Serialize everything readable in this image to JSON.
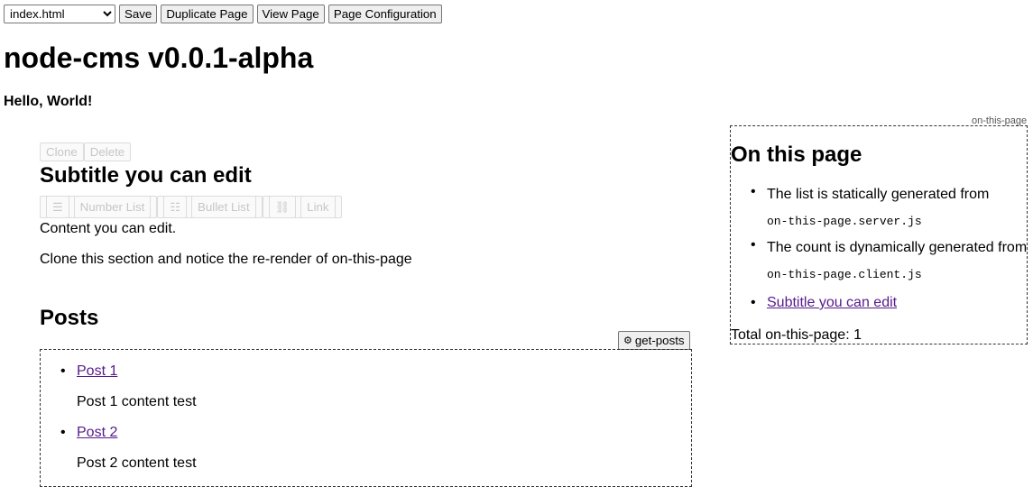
{
  "toolbar": {
    "selected_page": "index.html",
    "save": "Save",
    "duplicate": "Duplicate Page",
    "view": "View Page",
    "config": "Page Configuration"
  },
  "site_title": "node-cms v0.0.1-alpha",
  "greeting": "Hello, World!",
  "section": {
    "clone": "Clone",
    "delete": "Delete",
    "subtitle": "Subtitle you can edit",
    "number_list": "Number List",
    "bullet_list": "Bullet List",
    "link": "Link",
    "content_1": "Content you can edit.",
    "content_2": "Clone this section and notice the re-render of on-this-page"
  },
  "posts": {
    "title": "Posts",
    "button": "get-posts",
    "items": [
      {
        "title": "Post 1",
        "content": "Post 1 content test"
      },
      {
        "title": "Post 2",
        "content": "Post 2 content test"
      }
    ]
  },
  "aside": {
    "tag": "on-this-page",
    "title": "On this page",
    "item1_text": "The list is statically generated from",
    "item1_code": "on-this-page.server.js",
    "item2_text": "The count is dynamically generated from",
    "item2_code": "on-this-page.client.js",
    "item3_link": "Subtitle you can edit",
    "total": "Total on-this-page: 1"
  }
}
